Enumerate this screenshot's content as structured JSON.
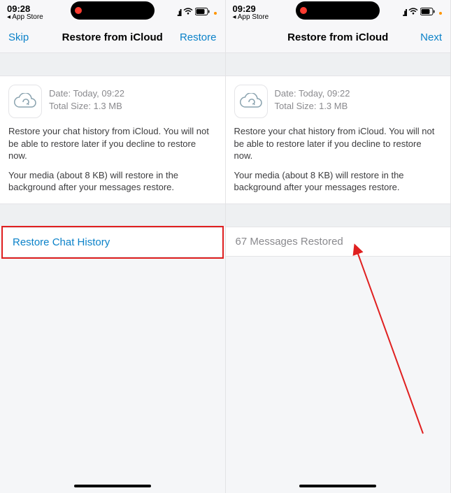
{
  "left": {
    "status": {
      "time": "09:28",
      "back": "◂ App Store"
    },
    "nav": {
      "leftLabel": "Skip",
      "title": "Restore from iCloud",
      "rightLabel": "Restore"
    },
    "info": {
      "dateLine": "Date: Today, 09:22",
      "sizeLine": "Total Size: 1.3 MB",
      "para1": "Restore your chat history from iCloud. You will not be able to restore later if you decline to restore now.",
      "para2": "Your media (about 8 KB) will restore in the background after your messages restore."
    },
    "action": {
      "label": "Restore Chat History"
    }
  },
  "right": {
    "status": {
      "time": "09:29",
      "back": "◂ App Store"
    },
    "nav": {
      "leftLabel": "",
      "title": "Restore from iCloud",
      "rightLabel": "Next"
    },
    "info": {
      "dateLine": "Date: Today, 09:22",
      "sizeLine": "Total Size: 1.3 MB",
      "para1": "Restore your chat history from iCloud. You will not be able to restore later if you decline to restore now.",
      "para2": "Your media (about 8 KB) will restore in the background after your messages restore."
    },
    "action": {
      "label": "67 Messages Restored"
    }
  }
}
